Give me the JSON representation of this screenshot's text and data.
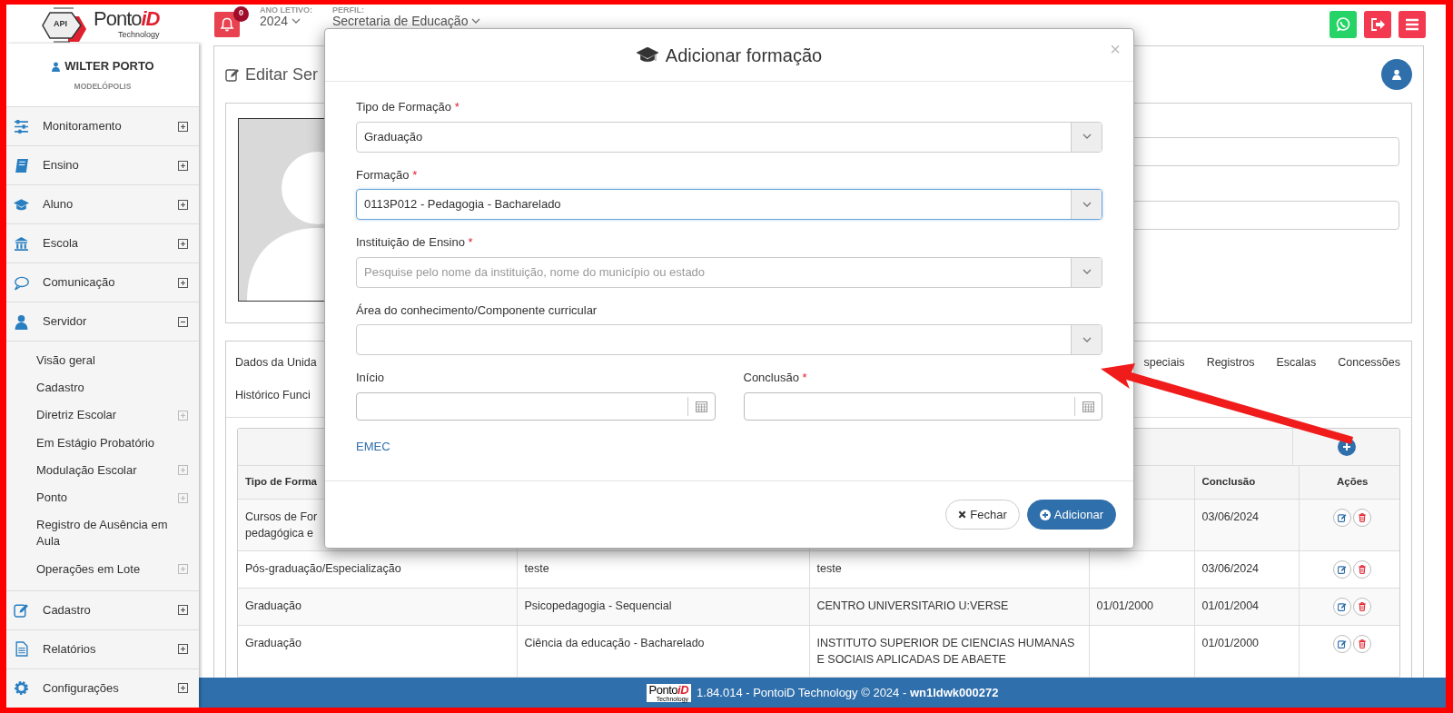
{
  "header": {
    "logo": {
      "badge": "API",
      "name": "Ponto",
      "name_accent": "iD",
      "tagline": "Technology"
    },
    "notifications": {
      "count": "0"
    },
    "school_year": {
      "label": "ANO LETIVO:",
      "value": "2024"
    },
    "profile": {
      "label": "PERFIL:",
      "value": "Secretaria de Educação"
    }
  },
  "sidebar": {
    "user": {
      "name": "WILTER PORTO",
      "city": "MODELÓPOLIS"
    },
    "items": [
      {
        "label": "Monitoramento",
        "expanded": false
      },
      {
        "label": "Ensino",
        "expanded": false
      },
      {
        "label": "Aluno",
        "expanded": false
      },
      {
        "label": "Escola",
        "expanded": false
      },
      {
        "label": "Comunicação",
        "expanded": false
      },
      {
        "label": "Servidor",
        "expanded": true,
        "children": [
          {
            "label": "Visão geral",
            "expandable": false
          },
          {
            "label": "Cadastro",
            "expandable": false
          },
          {
            "label": "Diretriz Escolar",
            "expandable": true
          },
          {
            "label": "Em Estágio Probatório",
            "expandable": false
          },
          {
            "label": "Modulação Escolar",
            "expandable": true
          },
          {
            "label": "Ponto",
            "expandable": true
          },
          {
            "label": "Registro de Ausência em Aula",
            "expandable": false
          },
          {
            "label": "Operações em Lote",
            "expandable": true
          }
        ]
      },
      {
        "label": "Cadastro",
        "expanded": false
      },
      {
        "label": "Relatórios",
        "expanded": false
      },
      {
        "label": "Configurações",
        "expanded": false
      }
    ]
  },
  "page": {
    "title": "Editar Ser",
    "tabs": {
      "row_1_start": [
        "Dados da Unida"
      ],
      "row_1_end": [
        "speciais",
        "Registros",
        "Escalas",
        "Concessões"
      ],
      "row_2": [
        "Histórico Funci"
      ]
    },
    "table": {
      "columns": [
        "Tipo de Forma",
        null,
        null,
        null,
        "Conclusão",
        "Ações"
      ],
      "rows": [
        [
          "Cursos de For\npedagógica e",
          null,
          null,
          null,
          "03/06/2024"
        ],
        [
          "Pós-graduação/Especialização",
          "teste",
          "teste",
          null,
          "03/06/2024"
        ],
        [
          "Graduação",
          "Psicopedagogia - Sequencial",
          "CENTRO UNIVERSITARIO U:VERSE",
          "01/01/2000",
          "01/01/2004"
        ],
        [
          "Graduação",
          "Ciência da educação - Bacharelado",
          "INSTITUTO SUPERIOR DE CIENCIAS HUMANAS E SOCIAIS APLICADAS DE ABAETE",
          null,
          "01/01/2000"
        ]
      ]
    }
  },
  "modal": {
    "title": "Adicionar formação",
    "close": "×",
    "fields": [
      {
        "kind": "select",
        "label": "Tipo de Formação",
        "required_mark": "*",
        "value": "Graduação",
        "focused": false
      },
      {
        "kind": "select",
        "label": "Formação",
        "required_mark": "*",
        "value": "0113P012 - Pedagogia - Bacharelado",
        "focused": true
      },
      {
        "kind": "select",
        "label": "Instituição de Ensino",
        "required_mark": "*",
        "placeholder": "Pesquise pelo nome da instituição, nome do município ou estado",
        "focused": false
      },
      {
        "kind": "select",
        "label": "Área do conhecimento/Componente curricular",
        "focused": false
      },
      {
        "kind": "date",
        "label": "Início",
        "focused": false
      },
      {
        "kind": "date",
        "label": "Conclusão",
        "required_mark": "*",
        "focused": false
      }
    ],
    "link": "EMEC",
    "buttons": [
      {
        "kind": "secondary",
        "label": "Fechar"
      },
      {
        "kind": "primary",
        "label": "Adicionar"
      }
    ]
  },
  "footer": {
    "logo": {
      "name": "Ponto",
      "name_accent": "iD",
      "tagline": "Technology"
    },
    "text": "1.84.014 - PontoiD Technology © 2024 - **wn1ldwk000272**"
  }
}
